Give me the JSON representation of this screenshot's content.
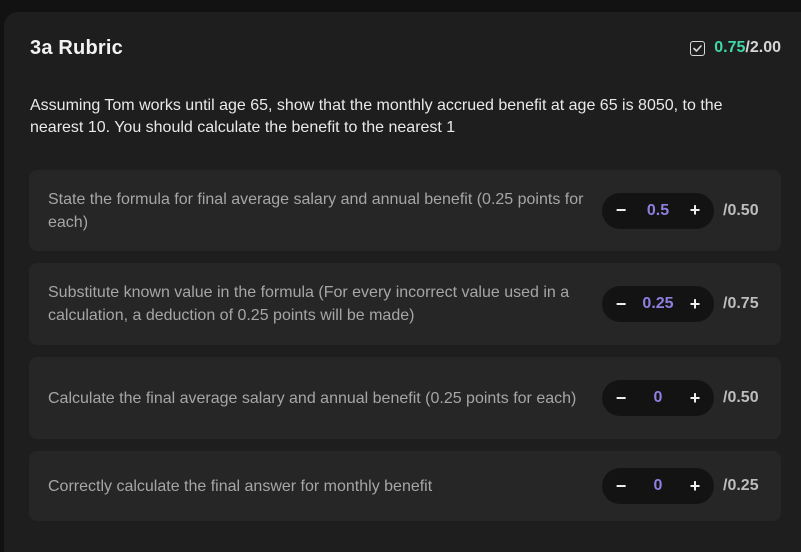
{
  "rubric": {
    "title": "3a Rubric",
    "score_obtained": "0.75",
    "score_separator": "/",
    "score_total": "2.00",
    "question": "Assuming Tom works until age 65, show that the monthly accrued benefit at age 65 is 8050, to the nearest 10. You should calculate the benefit to the nearest 1"
  },
  "criteria": [
    {
      "description": "State the formula for final average salary and annual benefit (0.25 points for each)",
      "minus": "−",
      "value": "0.5",
      "plus": "+",
      "max": "/0.50"
    },
    {
      "description": "Substitute known value in the formula (For every incorrect value used in a calculation, a deduction of 0.25 points will be made)",
      "minus": "−",
      "value": "0.25",
      "plus": "+",
      "max": "/0.75"
    },
    {
      "description": "Calculate the final average salary and annual benefit (0.25 points for each)",
      "minus": "−",
      "value": "0",
      "plus": "+",
      "max": "/0.50"
    },
    {
      "description": "Correctly calculate the final answer for monthly benefit",
      "minus": "−",
      "value": "0",
      "plus": "+",
      "max": "/0.25"
    }
  ],
  "icons": {
    "score": "checkbox-icon"
  },
  "colors": {
    "score_accent": "#3fd9a9",
    "stepper_value": "#8f7fe0"
  }
}
